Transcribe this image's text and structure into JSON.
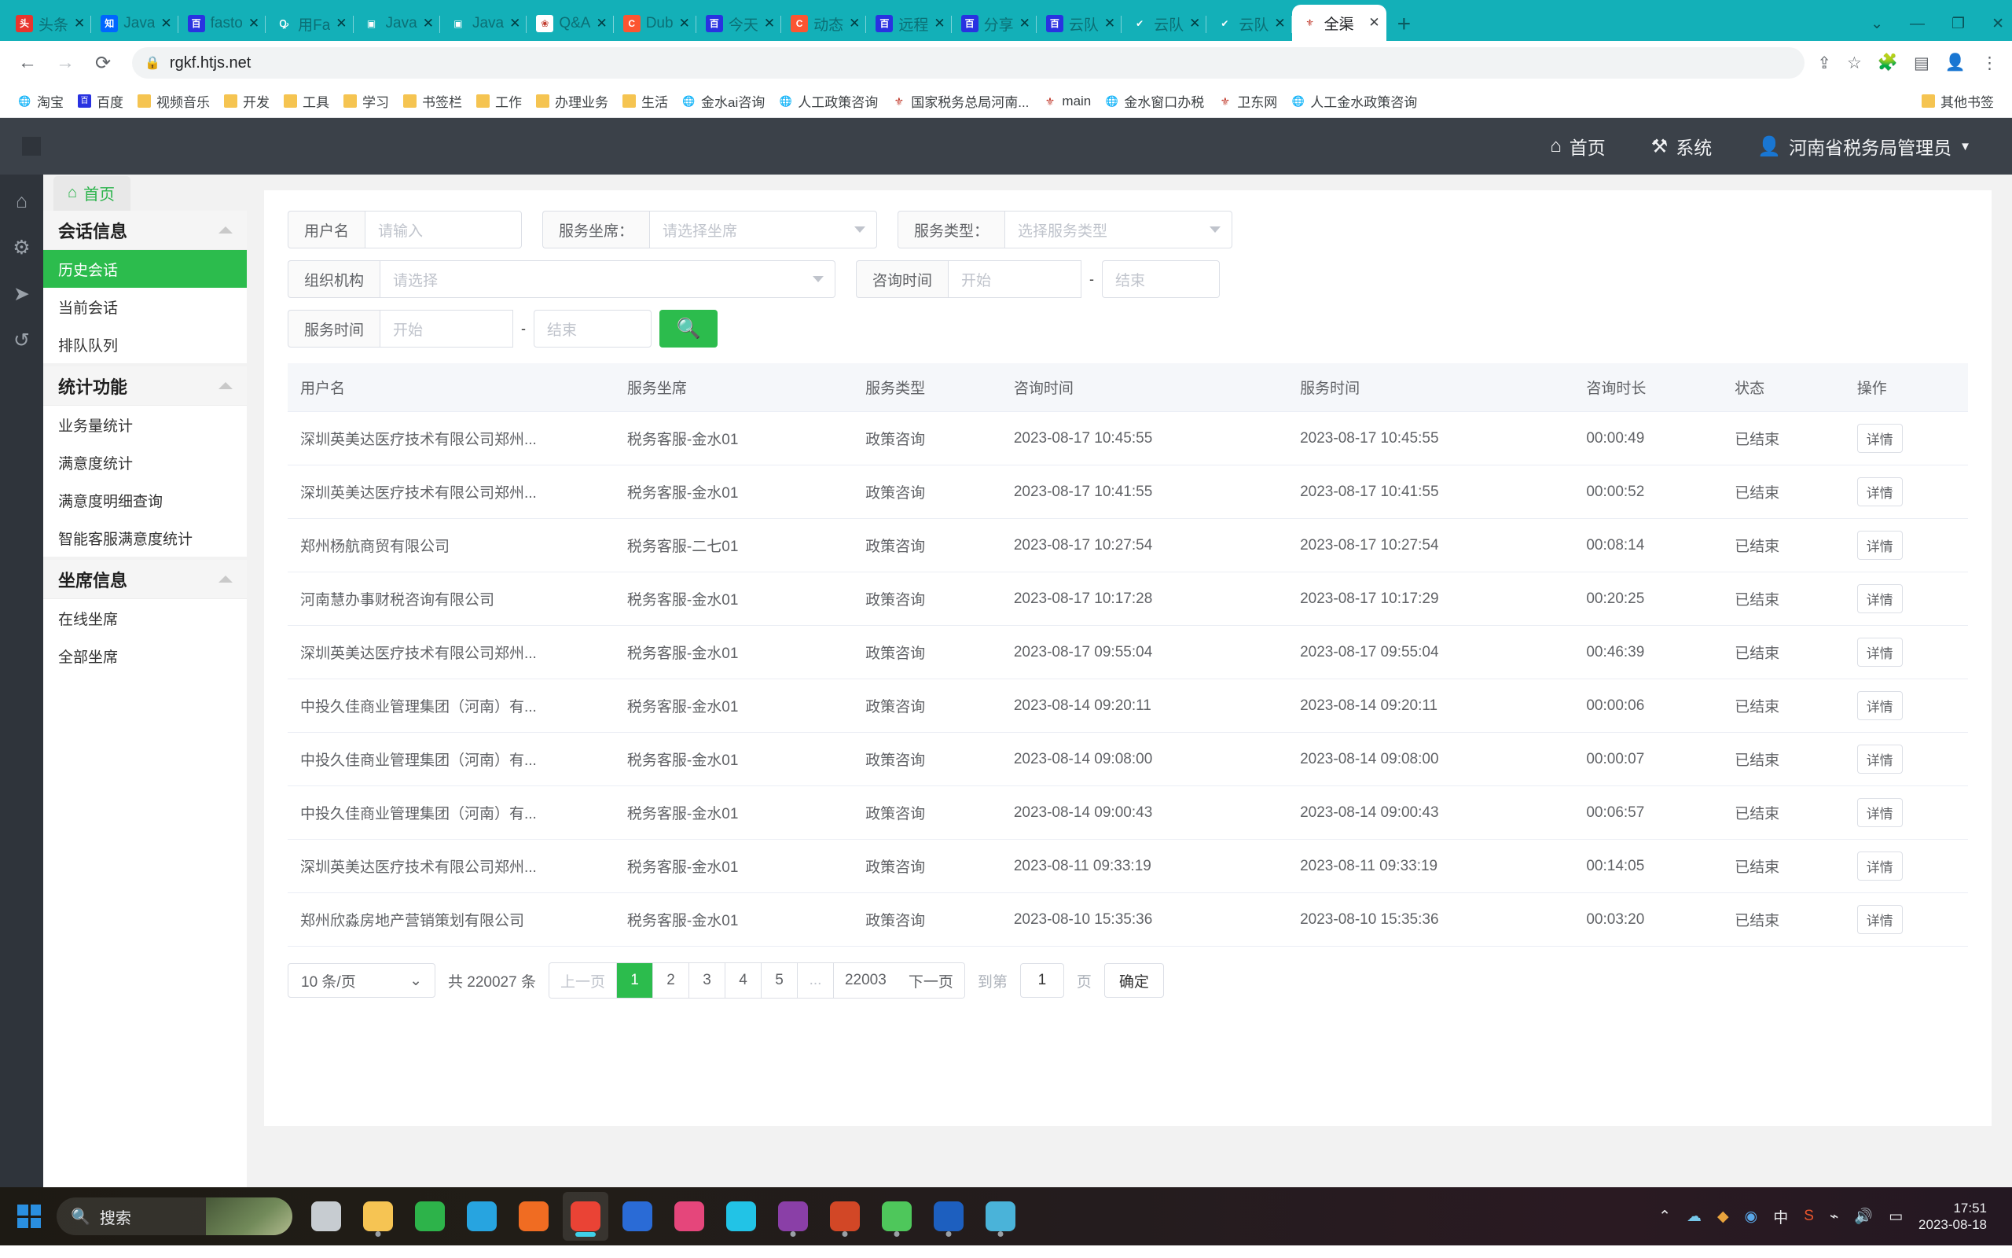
{
  "browser": {
    "tabs": [
      {
        "label": "头条",
        "icon": "toutiao-icon",
        "icon_bg": "#e8352e",
        "icon_text": "头",
        "active": false
      },
      {
        "label": "Java",
        "icon": "zhihu-icon",
        "icon_bg": "#0066ff",
        "icon_text": "知",
        "active": false
      },
      {
        "label": "fasto",
        "icon": "baidu-icon",
        "icon_bg": "#2932e1",
        "icon_text": "百",
        "active": false
      },
      {
        "label": "用Fa",
        "icon": "zhihu-search-icon",
        "icon_bg": "#13b0b8",
        "icon_text": "Ꝙ",
        "active": false
      },
      {
        "label": "Java",
        "icon": "robot-icon",
        "icon_bg": "#13b0b8",
        "icon_text": "▣",
        "active": false
      },
      {
        "label": "Java",
        "icon": "robot-icon",
        "icon_bg": "#13b0b8",
        "icon_text": "▣",
        "active": false
      },
      {
        "label": "Q&A",
        "icon": "segmentfault-icon",
        "icon_bg": "#ffffff",
        "icon_text": "❀",
        "active": false
      },
      {
        "label": "Dub",
        "icon": "csdn-icon",
        "icon_bg": "#fc5531",
        "icon_text": "C",
        "active": false
      },
      {
        "label": "今天",
        "icon": "baidu-icon",
        "icon_bg": "#2932e1",
        "icon_text": "百",
        "active": false
      },
      {
        "label": "动态",
        "icon": "csdn-icon",
        "icon_bg": "#fc5531",
        "icon_text": "C",
        "active": false
      },
      {
        "label": "远程",
        "icon": "baidu-icon",
        "icon_bg": "#2932e1",
        "icon_text": "百",
        "active": false
      },
      {
        "label": "分享",
        "icon": "baidu-icon",
        "icon_bg": "#2932e1",
        "icon_text": "百",
        "active": false
      },
      {
        "label": "云队",
        "icon": "baidu-icon",
        "icon_bg": "#2932e1",
        "icon_text": "百",
        "active": false
      },
      {
        "label": "云队",
        "icon": "teambition-icon",
        "icon_bg": "#13b0b8",
        "icon_text": "✔",
        "active": false
      },
      {
        "label": "云队",
        "icon": "teambition-icon",
        "icon_bg": "#13b0b8",
        "icon_text": "✔",
        "active": false
      },
      {
        "label": "全渠",
        "icon": "gov-emblem-icon",
        "icon_bg": "#ffffff",
        "icon_text": "⚜",
        "active": true
      }
    ],
    "new_tab_label": "+",
    "window_controls": [
      "⌄",
      "—",
      "❐",
      "✕"
    ],
    "nav": {
      "back": "←",
      "forward": "→",
      "reload": "⟳",
      "lock": "🔒",
      "url": "rgkf.htjs.net"
    },
    "nav_right": [
      "share-icon",
      "star-icon",
      "extensions-icon",
      "sidepanel-icon",
      "profile-icon",
      "menu-icon"
    ],
    "bookmarks": [
      {
        "label": "淘宝",
        "type": "globe"
      },
      {
        "label": "百度",
        "type": "baidu"
      },
      {
        "label": "视频音乐",
        "type": "folder"
      },
      {
        "label": "开发",
        "type": "folder"
      },
      {
        "label": "工具",
        "type": "folder"
      },
      {
        "label": "学习",
        "type": "folder"
      },
      {
        "label": "书签栏",
        "type": "folder"
      },
      {
        "label": "工作",
        "type": "folder"
      },
      {
        "label": "办理业务",
        "type": "folder"
      },
      {
        "label": "生活",
        "type": "folder"
      },
      {
        "label": "金水ai咨询",
        "type": "globe"
      },
      {
        "label": "人工政策咨询",
        "type": "globe"
      },
      {
        "label": "国家税务总局河南...",
        "type": "emblem"
      },
      {
        "label": "main",
        "type": "emblem"
      },
      {
        "label": "金水窗口办税",
        "type": "globe"
      },
      {
        "label": "卫东网",
        "type": "emblem"
      },
      {
        "label": "人工金水政策咨询",
        "type": "globe"
      }
    ],
    "other_bookmarks": {
      "label": "其他书签",
      "type": "folder"
    }
  },
  "app": {
    "header": {
      "home_label": "首页",
      "home_icon": "home-icon",
      "system_label": "系统",
      "system_icon": "tools-icon",
      "user_label": "河南省税务局管理员",
      "user_icon": "user-icon",
      "user_caret": "▼"
    },
    "rail_icons": [
      "home-icon",
      "gear-icon",
      "send-icon",
      "history-icon"
    ],
    "tab_home": {
      "label": "首页",
      "icon": "home-icon"
    },
    "sidebar": [
      {
        "title": "会话信息",
        "items": [
          {
            "label": "历史会话",
            "active": true
          },
          {
            "label": "当前会话",
            "active": false
          },
          {
            "label": "排队队列",
            "active": false
          }
        ]
      },
      {
        "title": "统计功能",
        "items": [
          {
            "label": "业务量统计",
            "active": false
          },
          {
            "label": "满意度统计",
            "active": false
          },
          {
            "label": "满意度明细查询",
            "active": false
          },
          {
            "label": "智能客服满意度统计",
            "active": false
          }
        ]
      },
      {
        "title": "坐席信息",
        "items": [
          {
            "label": "在线坐席",
            "active": false
          },
          {
            "label": "全部坐席",
            "active": false
          }
        ]
      }
    ],
    "search_form": {
      "username_label": "用户名",
      "username_placeholder": "请输入",
      "username_value": "",
      "agent_label": "服务坐席：",
      "agent_placeholder": "请选择坐席",
      "service_type_label": "服务类型：",
      "service_type_placeholder": "选择服务类型",
      "org_label": "组织机构",
      "org_placeholder": "请选择",
      "consult_time_label": "咨询时间",
      "service_time_label": "服务时间",
      "start_placeholder": "开始",
      "end_placeholder": "结束",
      "range_separator": "-",
      "search_icon": "search-icon"
    },
    "table": {
      "columns": [
        "用户名",
        "服务坐席",
        "服务类型",
        "咨询时间",
        "服务时间",
        "咨询时长",
        "状态",
        "操作"
      ],
      "action_label": "详情",
      "rows": [
        [
          "深圳英美达医疗技术有限公司郑州...",
          "税务客服-金水01",
          "政策咨询",
          "2023-08-17 10:45:55",
          "2023-08-17 10:45:55",
          "00:00:49",
          "已结束"
        ],
        [
          "深圳英美达医疗技术有限公司郑州...",
          "税务客服-金水01",
          "政策咨询",
          "2023-08-17 10:41:55",
          "2023-08-17 10:41:55",
          "00:00:52",
          "已结束"
        ],
        [
          "郑州杨航商贸有限公司",
          "税务客服-二七01",
          "政策咨询",
          "2023-08-17 10:27:54",
          "2023-08-17 10:27:54",
          "00:08:14",
          "已结束"
        ],
        [
          "河南慧办事财税咨询有限公司",
          "税务客服-金水01",
          "政策咨询",
          "2023-08-17 10:17:28",
          "2023-08-17 10:17:29",
          "00:20:25",
          "已结束"
        ],
        [
          "深圳英美达医疗技术有限公司郑州...",
          "税务客服-金水01",
          "政策咨询",
          "2023-08-17 09:55:04",
          "2023-08-17 09:55:04",
          "00:46:39",
          "已结束"
        ],
        [
          "中投久佳商业管理集团（河南）有...",
          "税务客服-金水01",
          "政策咨询",
          "2023-08-14 09:20:11",
          "2023-08-14 09:20:11",
          "00:00:06",
          "已结束"
        ],
        [
          "中投久佳商业管理集团（河南）有...",
          "税务客服-金水01",
          "政策咨询",
          "2023-08-14 09:08:00",
          "2023-08-14 09:08:00",
          "00:00:07",
          "已结束"
        ],
        [
          "中投久佳商业管理集团（河南）有...",
          "税务客服-金水01",
          "政策咨询",
          "2023-08-14 09:00:43",
          "2023-08-14 09:00:43",
          "00:06:57",
          "已结束"
        ],
        [
          "深圳英美达医疗技术有限公司郑州...",
          "税务客服-金水01",
          "政策咨询",
          "2023-08-11 09:33:19",
          "2023-08-11 09:33:19",
          "00:14:05",
          "已结束"
        ],
        [
          "郑州欣淼房地产营销策划有限公司",
          "税务客服-金水01",
          "政策咨询",
          "2023-08-10 15:35:36",
          "2023-08-10 15:35:36",
          "00:03:20",
          "已结束"
        ]
      ]
    },
    "pagination": {
      "page_size": "10 条/页",
      "total": "共 220027 条",
      "prev": "上一页",
      "pages": [
        "1",
        "2",
        "3",
        "4",
        "5",
        "...",
        "22003"
      ],
      "current_page": "1",
      "next": "下一页",
      "jump_prefix": "到第",
      "jump_value": "1",
      "jump_suffix": "页",
      "confirm": "确定"
    },
    "accent_color": "#2cbc4d"
  },
  "taskbar": {
    "search_placeholder": "搜索",
    "search_icon": "search-icon",
    "start_icon": "windows-icon",
    "apps": [
      {
        "name": "task-view",
        "color": "#c7ccd1",
        "active": false,
        "dot": false
      },
      {
        "name": "file-explorer",
        "color": "#f6c453",
        "active": false,
        "dot": true
      },
      {
        "name": "internet-explorer",
        "color": "#2db34a",
        "active": false,
        "dot": false
      },
      {
        "name": "edge-legacy",
        "color": "#27a4e0",
        "active": false,
        "dot": false
      },
      {
        "name": "firefox",
        "color": "#f06c22",
        "active": false,
        "dot": false
      },
      {
        "name": "chrome",
        "color": "#ea4335",
        "active": true,
        "dot": true
      },
      {
        "name": "sogou-browser",
        "color": "#2a6bd6",
        "active": false,
        "dot": false
      },
      {
        "name": "intellij-idea",
        "color": "#e5467b",
        "active": false,
        "dot": false
      },
      {
        "name": "webstorm",
        "color": "#22c3e6",
        "active": false,
        "dot": false
      },
      {
        "name": "onenote",
        "color": "#8a3fa7",
        "active": false,
        "dot": true
      },
      {
        "name": "powerpoint",
        "color": "#d24726",
        "active": false,
        "dot": true
      },
      {
        "name": "wechat",
        "color": "#4ec75b",
        "active": false,
        "dot": true
      },
      {
        "name": "word",
        "color": "#1d5fbf",
        "active": false,
        "dot": true
      },
      {
        "name": "calculator",
        "color": "#4ab3d9",
        "active": false,
        "dot": true
      }
    ],
    "tray": [
      "^",
      "cloud-icon",
      "shield-icon",
      "globe-icon",
      "ime-中",
      "sogou-icon",
      "wifi-icon",
      "volume-icon",
      "battery-icon"
    ],
    "clock_time": "17:51",
    "clock_date": "2023-08-18"
  }
}
